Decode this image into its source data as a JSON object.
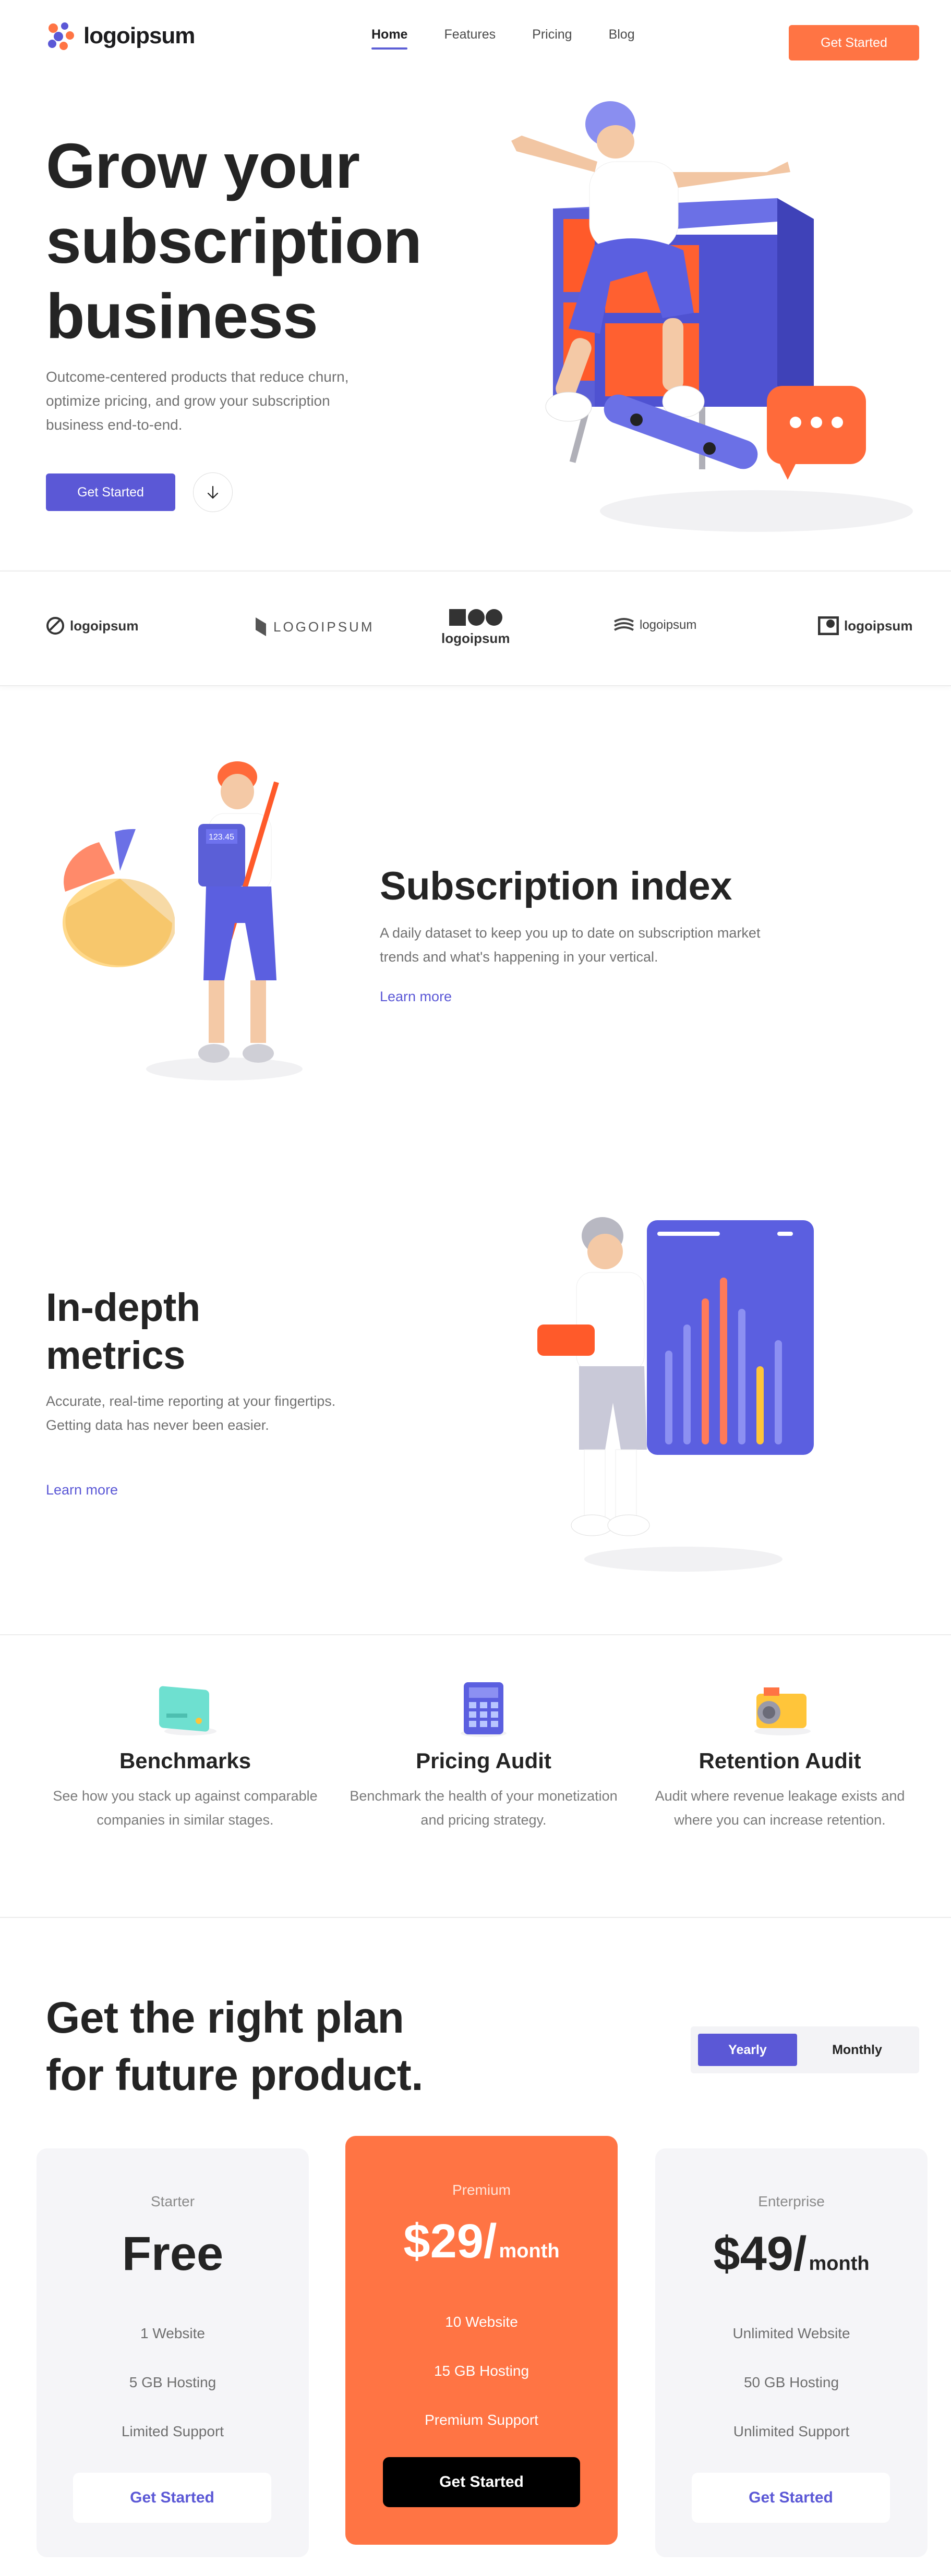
{
  "header": {
    "logo_text": "logoipsum",
    "logo_mark": "logoipsum",
    "nav": [
      {
        "label": "Home",
        "active": true
      },
      {
        "label": "Features",
        "active": false
      },
      {
        "label": "Pricing",
        "active": false
      },
      {
        "label": "Blog",
        "active": false
      }
    ],
    "cta": "Get Started"
  },
  "hero": {
    "title_lines": [
      "Grow your",
      "subscription",
      "business"
    ],
    "subtitle": "Outcome-centered products that reduce churn, optimize pricing, and grow your subscription business end-to-end.",
    "cta": "Get Started",
    "scroll_icon": "arrow-down-icon"
  },
  "brands": [
    "logoipsum",
    "LOGOIPSUM",
    "logoipsum",
    "logoipsum",
    "logoipsum"
  ],
  "feature1": {
    "title": "Subscription index",
    "text": "A daily dataset to keep you up to date on subscription market trends and what's happening in your vertical.",
    "link": "Learn more",
    "calc_display": "123.45"
  },
  "feature2": {
    "title_lines": [
      "In-depth",
      "metrics"
    ],
    "text": "Accurate, real-time reporting at your fingertips. Getting data has never been easier.",
    "link": "Learn more"
  },
  "services": [
    {
      "title": "Benchmarks",
      "text": "See how you stack up against comparable companies in similar stages.",
      "icon": "credit-card-icon"
    },
    {
      "title": "Pricing Audit",
      "text": "Benchmark the health of your monetization and pricing strategy.",
      "icon": "calculator-icon"
    },
    {
      "title": "Retention Audit",
      "text": "Audit where revenue leakage exists and where you can increase retention.",
      "icon": "camera-icon"
    }
  ],
  "pricing": {
    "title_lines": [
      "Get the right plan",
      "for future product."
    ],
    "toggle": {
      "yearly": "Yearly",
      "monthly": "Monthly",
      "selected": "Yearly"
    },
    "plans": [
      {
        "name": "Starter",
        "price": "Free",
        "per": "",
        "features": [
          "1 Website",
          "5 GB Hosting",
          "Limited Support"
        ],
        "cta": "Get Started"
      },
      {
        "name": "Premium",
        "price": "$29/",
        "per": "month",
        "features": [
          "10 Website",
          "15 GB Hosting",
          "Premium Support"
        ],
        "cta": "Get Started"
      },
      {
        "name": "Enterprise",
        "price": "$49/",
        "per": "month",
        "features": [
          "Unlimited Website",
          "50 GB Hosting",
          "Unlimited Support"
        ],
        "cta": "Get Started"
      }
    ]
  },
  "colors": {
    "accent": "#5b58d6",
    "orange": "#ff7444",
    "text": "#242424",
    "muted": "#717171"
  }
}
